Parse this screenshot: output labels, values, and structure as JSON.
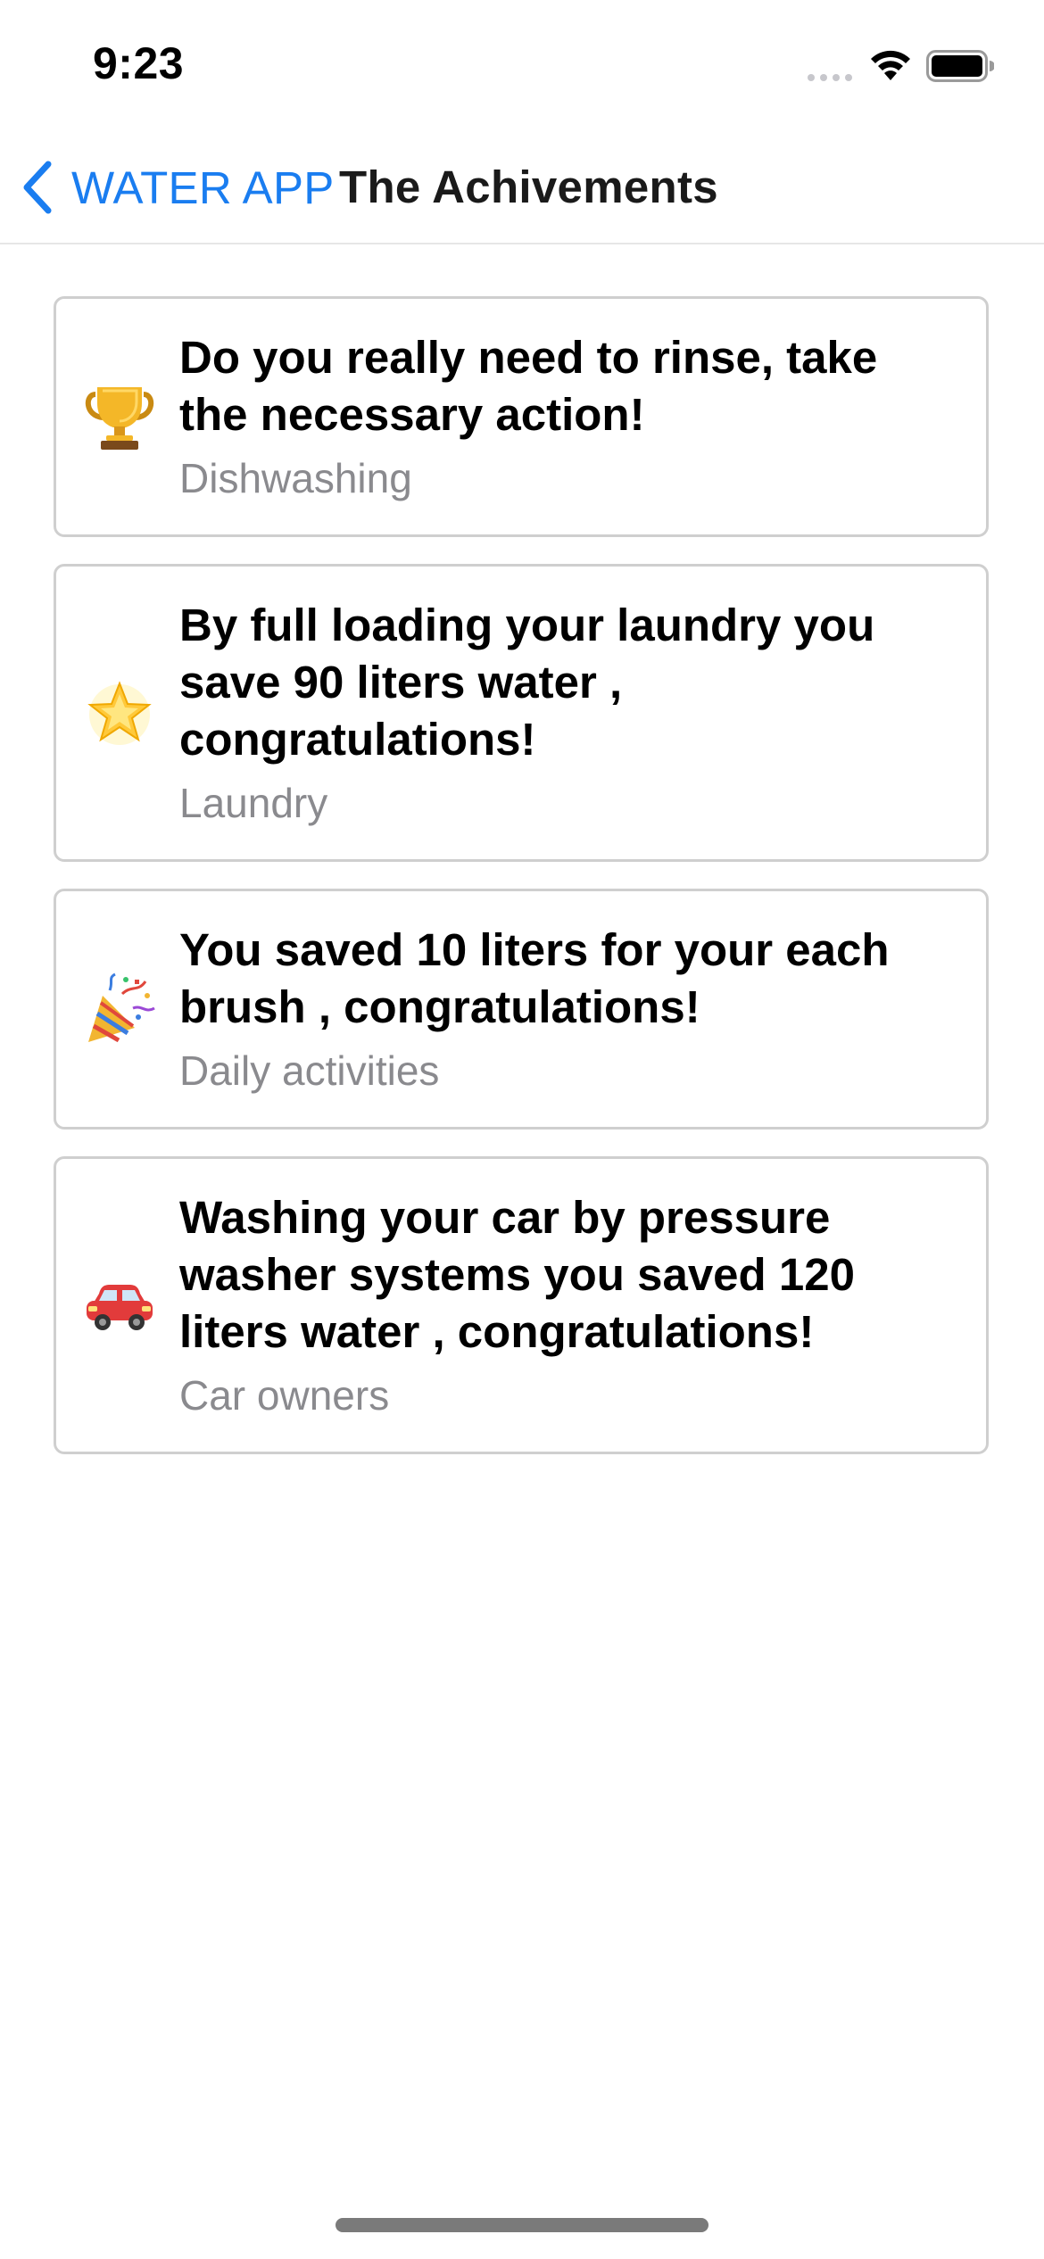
{
  "status_bar": {
    "time": "9:23"
  },
  "nav": {
    "back_label": "WATER APP",
    "title": "The Achivements"
  },
  "achievements": [
    {
      "icon": "trophy-icon",
      "title": "Do you really need to rinse, take the necessary action!",
      "category": "Dishwashing"
    },
    {
      "icon": "glowing-star-icon",
      "title": "By full loading your laundry you save 90 liters water , congratulations!",
      "category": "Laundry"
    },
    {
      "icon": "party-popper-icon",
      "title": "You saved 10 liters for your each brush , congratulations!",
      "category": "Daily activities"
    },
    {
      "icon": "red-car-icon",
      "title": "Washing your car by pressure washer systems you saved 120 liters water , congratulations!",
      "category": "Car owners"
    }
  ],
  "colors": {
    "accent": "#1a7df0",
    "secondary_text": "#8a8a8e",
    "card_border": "#cfcfcf"
  }
}
